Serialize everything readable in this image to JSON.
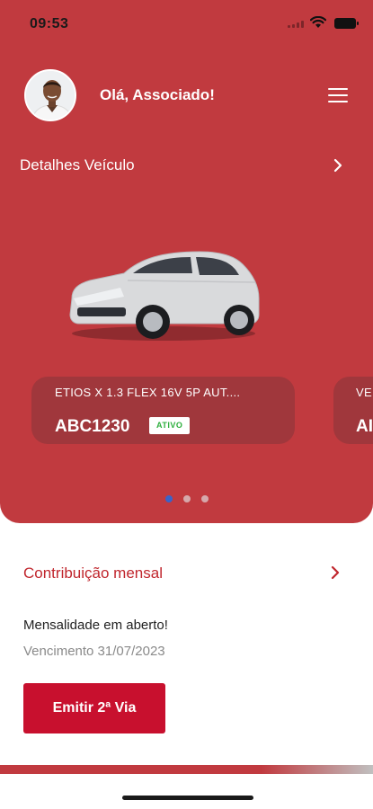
{
  "status_bar": {
    "time": "09:53"
  },
  "header": {
    "greeting": "Olá, Associado!",
    "avatar_icon": "user-avatar",
    "menu_icon": "hamburger-menu-icon"
  },
  "details": {
    "label": "Detalhes Veículo",
    "chevron_icon": "chevron-right-icon"
  },
  "vehicles": [
    {
      "model": "ETIOS X 1.3 FLEX 16V 5P AUT....",
      "plate": "ABC1230",
      "status": "ATIVO"
    },
    {
      "model": "VE",
      "plate": "AI"
    }
  ],
  "carousel": {
    "page_count": 3,
    "active_index": 0,
    "active_color": "#3a63c8",
    "inactive_color": "#d6a8ab"
  },
  "contribution": {
    "label": "Contribuição mensal",
    "due_title": "Mensalidade em aberto!",
    "due_date": "Vencimento 31/07/2023",
    "button_label": "Emitir 2ª Via"
  },
  "colors": {
    "brand": "#c13a3f",
    "card": "#a0373c",
    "accent_red": "#c8102e",
    "status_active": "#2eaf3d"
  }
}
